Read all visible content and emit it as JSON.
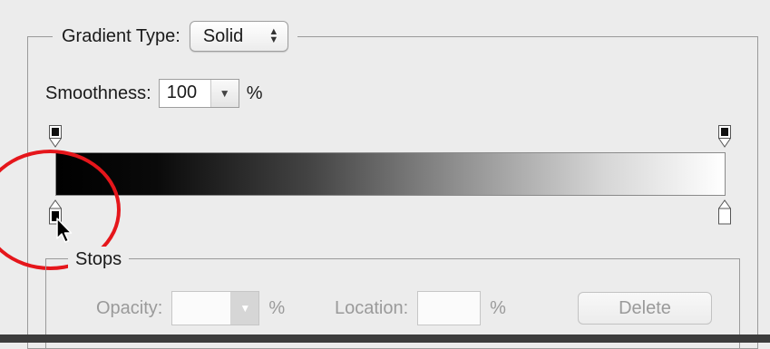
{
  "gradient_type": {
    "label": "Gradient Type:",
    "value": "Solid",
    "icon": "updown-arrows-icon"
  },
  "smoothness": {
    "label": "Smoothness:",
    "value": "100",
    "unit": "%"
  },
  "gradient": {
    "start_color": "#000000",
    "end_color": "#ffffff",
    "opacity_stops": [
      "left-opacity-stop",
      "right-opacity-stop"
    ],
    "color_stops": [
      "left-color-stop (selected)",
      "right-color-stop"
    ]
  },
  "stops": {
    "title": "Stops",
    "opacity_label": "Opacity:",
    "opacity_unit": "%",
    "location_label": "Location:",
    "location_unit": "%",
    "delete_label": "Delete"
  },
  "annotation": {
    "highlight_color": "#e5161b"
  }
}
